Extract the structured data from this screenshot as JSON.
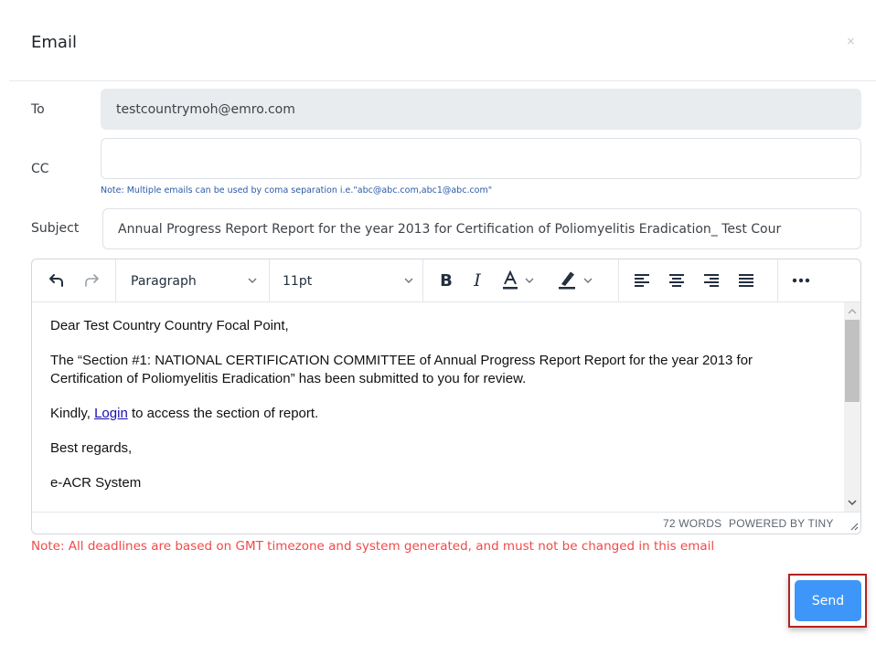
{
  "dialog": {
    "title": "Email",
    "close_symbol": "×"
  },
  "form": {
    "to_label": "To",
    "to_value": "testcountrymoh@emro.com",
    "cc_label": "CC",
    "cc_value": "",
    "cc_note": "Note: Multiple emails can be used by coma separation i.e.\"abc@abc.com,abc1@abc.com\"",
    "subject_label": "Subject",
    "subject_value": "Annual Progress Report Report for the year 2013 for Certification of Poliomyelitis Eradication_ Test Cour"
  },
  "editor": {
    "toolbar": {
      "block_format": "Paragraph",
      "font_size": "11pt",
      "icons": [
        "undo-icon",
        "redo-icon",
        "bold-icon",
        "italic-icon",
        "text-color-icon",
        "highlight-color-icon",
        "align-left-icon",
        "align-center-icon",
        "align-right-icon",
        "align-justify-icon",
        "more-icon"
      ]
    },
    "body": {
      "greeting": "Dear Test Country Country Focal Point,",
      "paragraph1": "The “Section #1: NATIONAL CERTIFICATION COMMITTEE of Annual Progress Report Report for the year 2013 for Certification of Poliomyelitis Eradication” has been submitted to you for review.",
      "kindly_prefix": "Kindly, ",
      "login_link": "Login",
      "kindly_suffix": " to access the section of report.",
      "closing": "Best regards,",
      "signature": "e-ACR System"
    },
    "status": {
      "word_count": "72 WORDS",
      "powered_by": "POWERED BY TINY"
    }
  },
  "deadline_note": "Note: All deadlines are based on GMT timezone and system generated, and must not be changed in this email",
  "actions": {
    "send_label": "Send"
  },
  "colors": {
    "send_button": "#3e97f8",
    "note_red": "#f04a4a",
    "note_blue": "#2b5aa8",
    "highlight_border": "#b32222"
  }
}
